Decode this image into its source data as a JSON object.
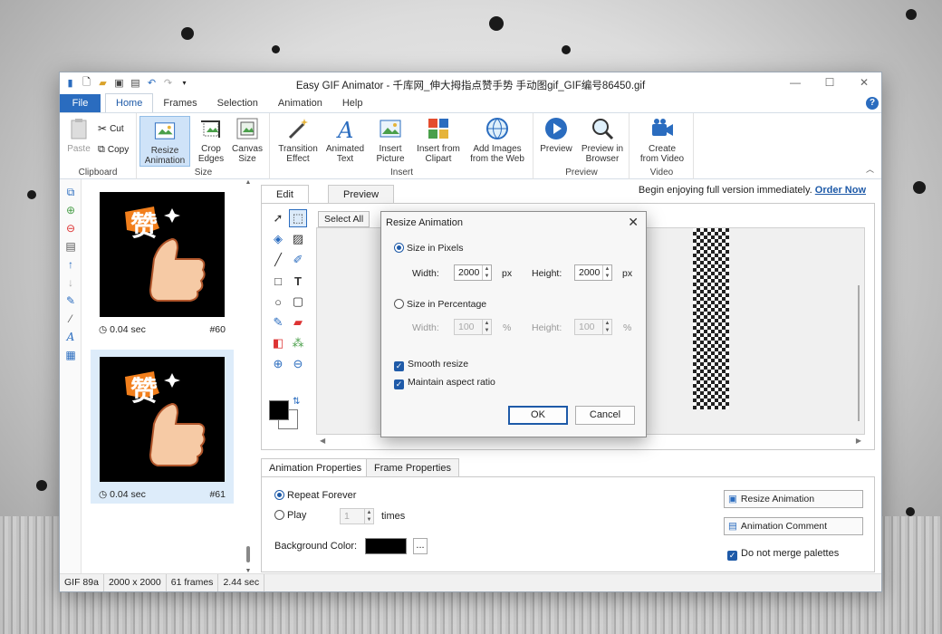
{
  "window": {
    "title": "Easy GIF Animator - 千库网_伸大拇指点赞手势 手动图gif_GIF编号86450.gif"
  },
  "tabs": [
    "File",
    "Home",
    "Frames",
    "Selection",
    "Animation",
    "Help"
  ],
  "ribbon": {
    "clipboard": {
      "label": "Clipboard",
      "paste": "Paste",
      "cut": "Cut",
      "copy": "Copy"
    },
    "size": {
      "label": "Size",
      "resize": "Resize\nAnimation",
      "crop": "Crop\nEdges",
      "canvas": "Canvas\nSize"
    },
    "insert": {
      "label": "Insert",
      "transition": "Transition\nEffect",
      "animated_text": "Animated\nText",
      "insert_picture": "Insert\nPicture",
      "insert_clipart": "Insert from\nClipart",
      "add_images": "Add Images\nfrom the Web"
    },
    "preview": {
      "label": "Preview",
      "preview": "Preview",
      "preview_browser": "Preview in\nBrowser"
    },
    "video": {
      "label": "Video",
      "create": "Create\nfrom Video"
    }
  },
  "frames": [
    {
      "time": "0.04 sec",
      "num": "#60",
      "glyph": "赞"
    },
    {
      "time": "0.04 sec",
      "num": "#61",
      "glyph": "赞"
    }
  ],
  "editor": {
    "tab_edit": "Edit",
    "tab_preview": "Preview",
    "select_all": "Select All",
    "banner_text": "Begin enjoying full version immediately.",
    "order_now": "Order Now"
  },
  "properties": {
    "tab_animation": "Animation Properties",
    "tab_frame": "Frame Properties",
    "repeat_forever": "Repeat Forever",
    "play": "Play",
    "play_count": "1",
    "times": "times",
    "bg_color_label": "Background Color:",
    "bg_color": "#000000",
    "ellipsis": "...",
    "resize_button": "Resize Animation",
    "comment_button": "Animation Comment",
    "no_merge": "Do not merge palettes"
  },
  "status": {
    "format": "GIF 89a",
    "dimensions": "2000 x 2000",
    "frames": "61 frames",
    "duration": "2.44 sec"
  },
  "dialog": {
    "title": "Resize Animation",
    "size_pixels": "Size in Pixels",
    "width_label": "Width:",
    "height_label": "Height:",
    "width_px": "2000",
    "height_px": "2000",
    "px": "px",
    "size_percent": "Size in Percentage",
    "width_pct": "100",
    "height_pct": "100",
    "pct": "%",
    "smooth": "Smooth resize",
    "aspect": "Maintain aspect ratio",
    "ok": "OK",
    "cancel": "Cancel"
  },
  "colors": {
    "accent": "#1e5aa8",
    "file_tab": "#2a6cbf"
  }
}
